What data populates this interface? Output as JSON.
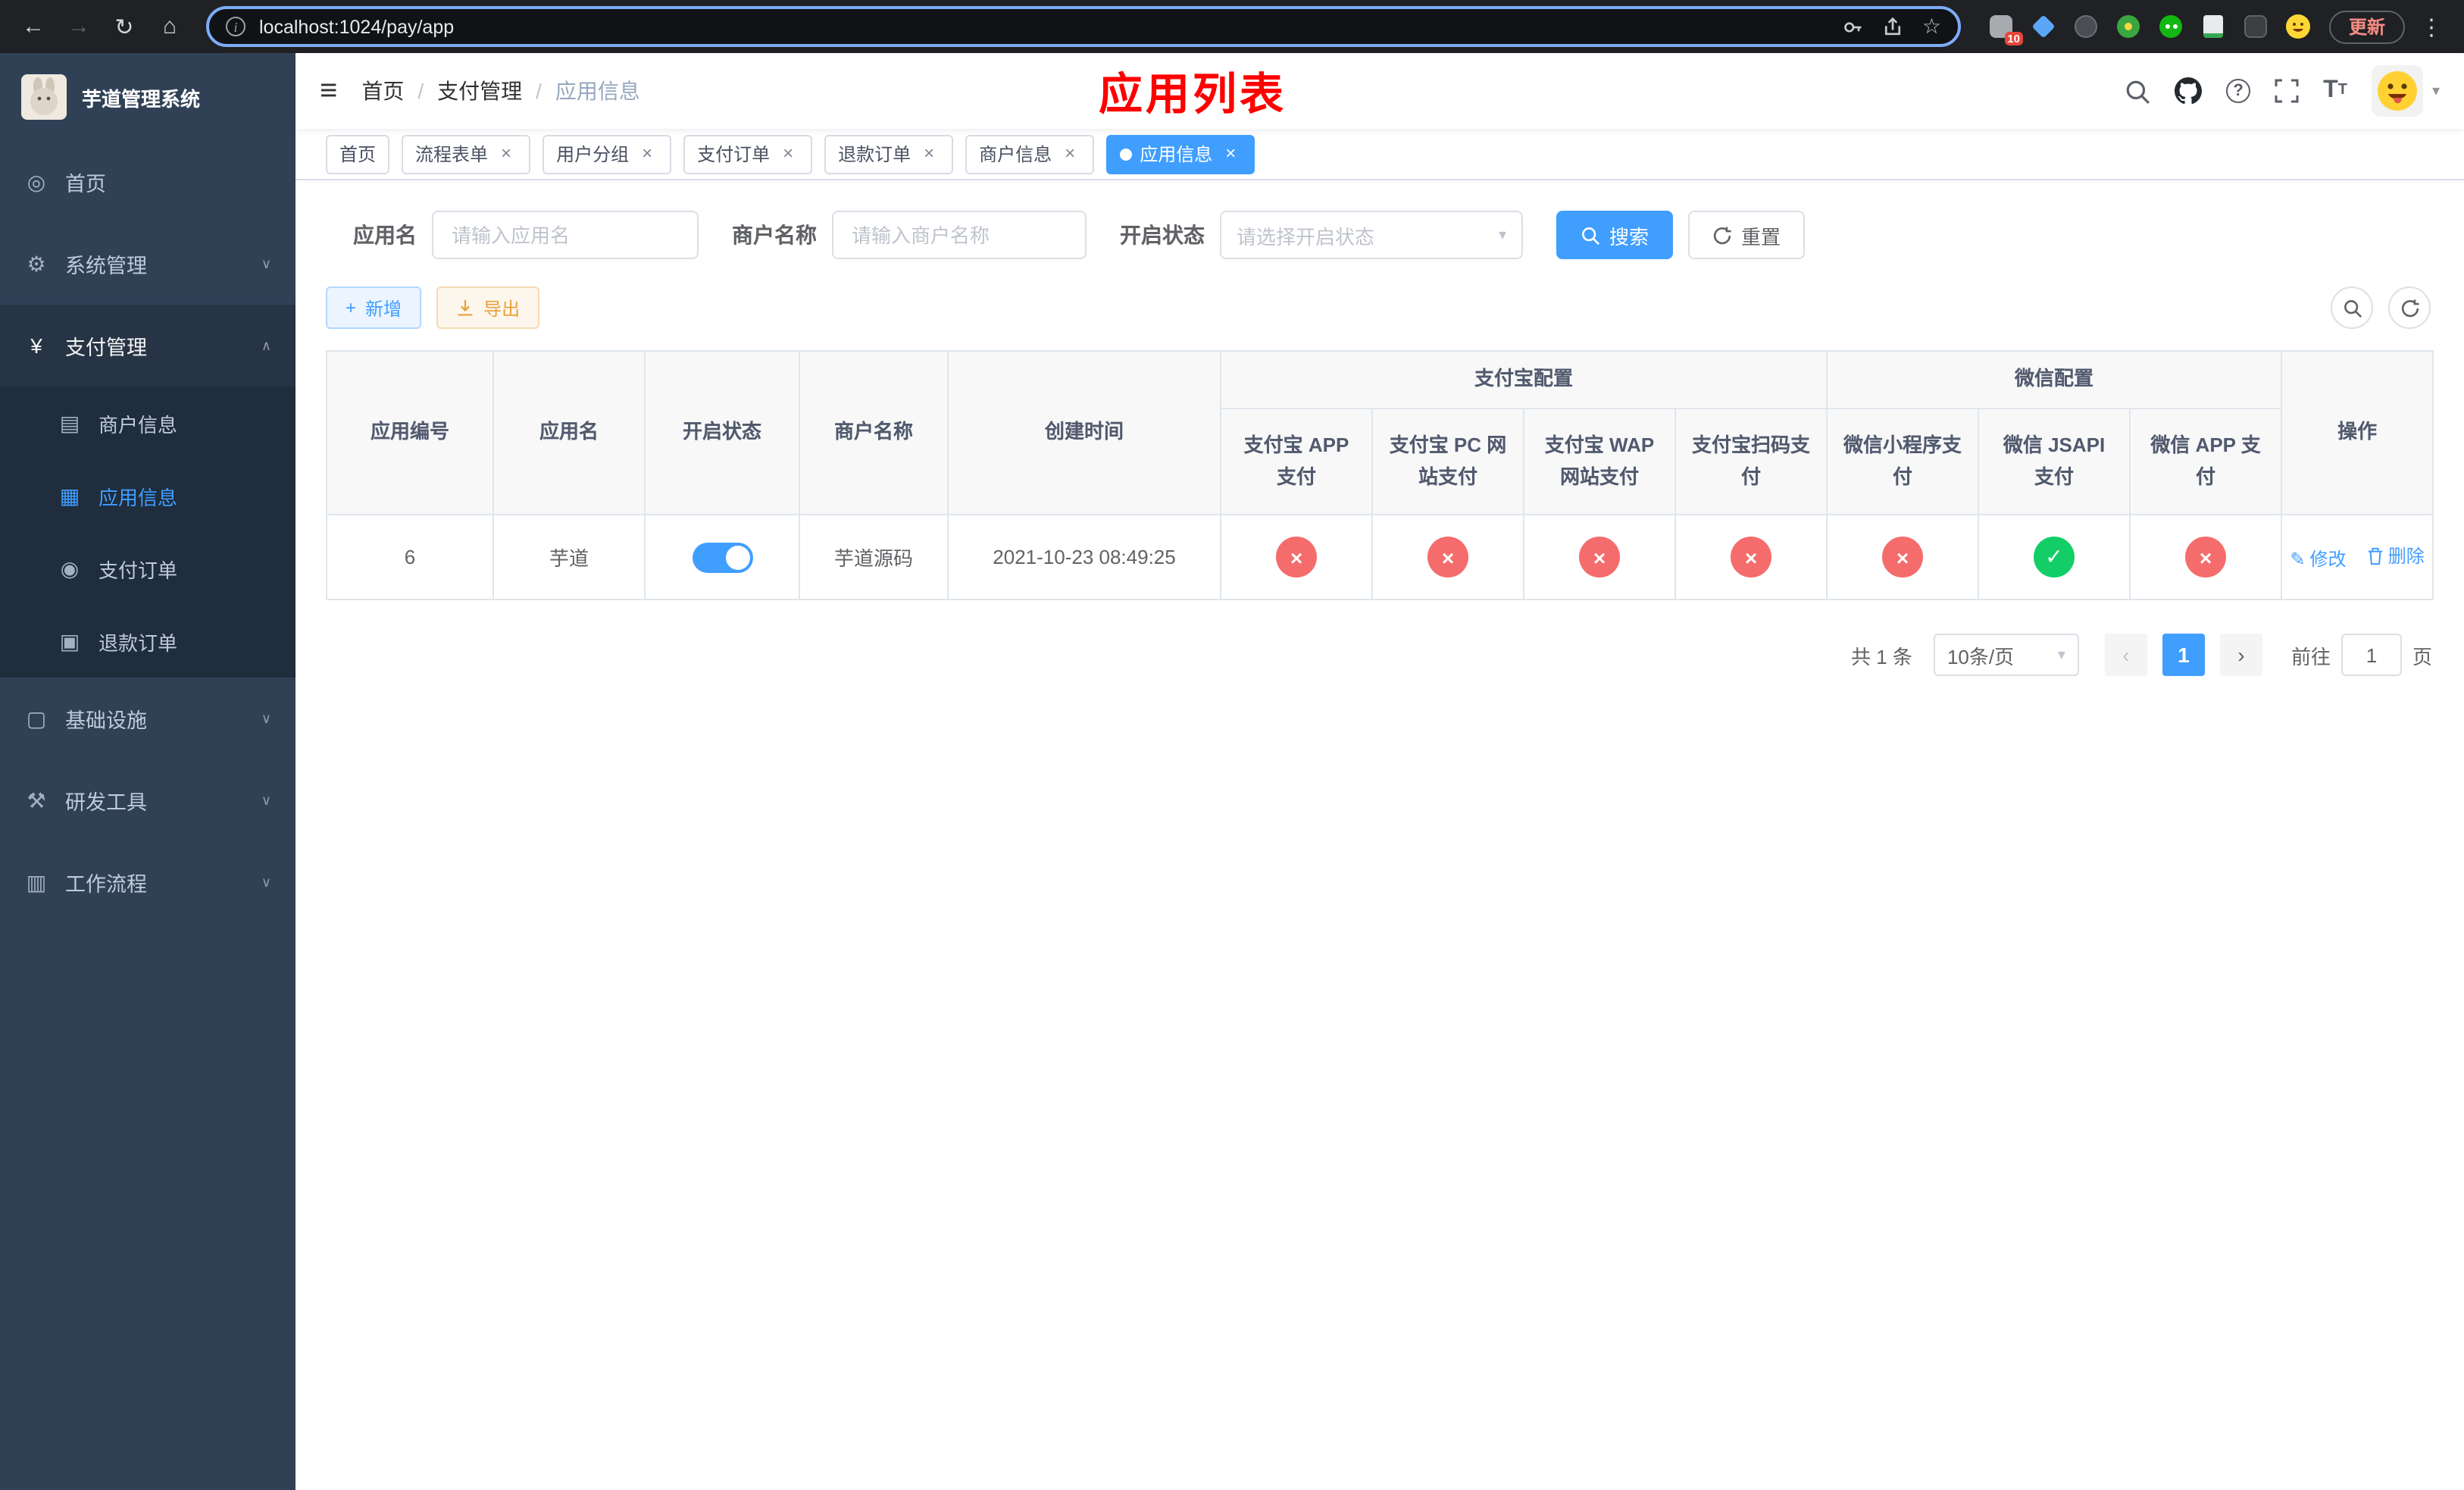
{
  "browser": {
    "url": "localhost:1024/pay/app",
    "update_label": "更新",
    "extension_badge": "10"
  },
  "sidebar": {
    "title": "芋道管理系统",
    "items": [
      {
        "label": "首页"
      },
      {
        "label": "系统管理"
      },
      {
        "label": "支付管理"
      },
      {
        "label": "基础设施"
      },
      {
        "label": "研发工具"
      },
      {
        "label": "工作流程"
      }
    ],
    "submenu": [
      {
        "label": "商户信息"
      },
      {
        "label": "应用信息"
      },
      {
        "label": "支付订单"
      },
      {
        "label": "退款订单"
      }
    ]
  },
  "navbar": {
    "breadcrumb": [
      "首页",
      "支付管理",
      "应用信息"
    ],
    "page_title": "应用列表"
  },
  "tabs": [
    {
      "label": "首页"
    },
    {
      "label": "流程表单"
    },
    {
      "label": "用户分组"
    },
    {
      "label": "支付订单"
    },
    {
      "label": "退款订单"
    },
    {
      "label": "商户信息"
    },
    {
      "label": "应用信息"
    }
  ],
  "filters": {
    "app_name_label": "应用名",
    "app_name_placeholder": "请输入应用名",
    "merchant_label": "商户名称",
    "merchant_placeholder": "请输入商户名称",
    "status_label": "开启状态",
    "status_placeholder": "请选择开启状态",
    "search_label": "搜索",
    "reset_label": "重置"
  },
  "toolbar": {
    "add_label": "新增",
    "export_label": "导出"
  },
  "table": {
    "groups": {
      "alipay": "支付宝配置",
      "wechat": "微信配置"
    },
    "columns": {
      "id": "应用编号",
      "name": "应用名",
      "status": "开启状态",
      "merchant": "商户名称",
      "created": "创建时间",
      "alipay_app": "支付宝 APP 支付",
      "alipay_pc": "支付宝 PC 网站支付",
      "alipay_wap": "支付宝 WAP 网站支付",
      "alipay_qr": "支付宝扫码支付",
      "wx_lite": "微信小程序支付",
      "wx_jsapi": "微信 JSAPI 支付",
      "wx_app": "微信 APP 支付",
      "actions": "操作"
    },
    "rows": [
      {
        "id": "6",
        "name": "芋道",
        "status_on": true,
        "merchant": "芋道源码",
        "created": "2021-10-23 08:49:25",
        "configs": [
          false,
          false,
          false,
          false,
          false,
          true,
          false
        ],
        "edit_label": "修改",
        "delete_label": "删除"
      }
    ]
  },
  "pagination": {
    "total": "共 1 条",
    "page_size": "10条/页",
    "current_page": "1",
    "goto_label": "前往",
    "goto_value": "1",
    "page_unit": "页"
  },
  "colors": {
    "primary": "#409eff",
    "danger": "#f56c6c",
    "success": "#13ce66",
    "title_red": "#ff0000",
    "sidebar_bg": "#304156",
    "submenu_bg": "#1f2d3d"
  }
}
